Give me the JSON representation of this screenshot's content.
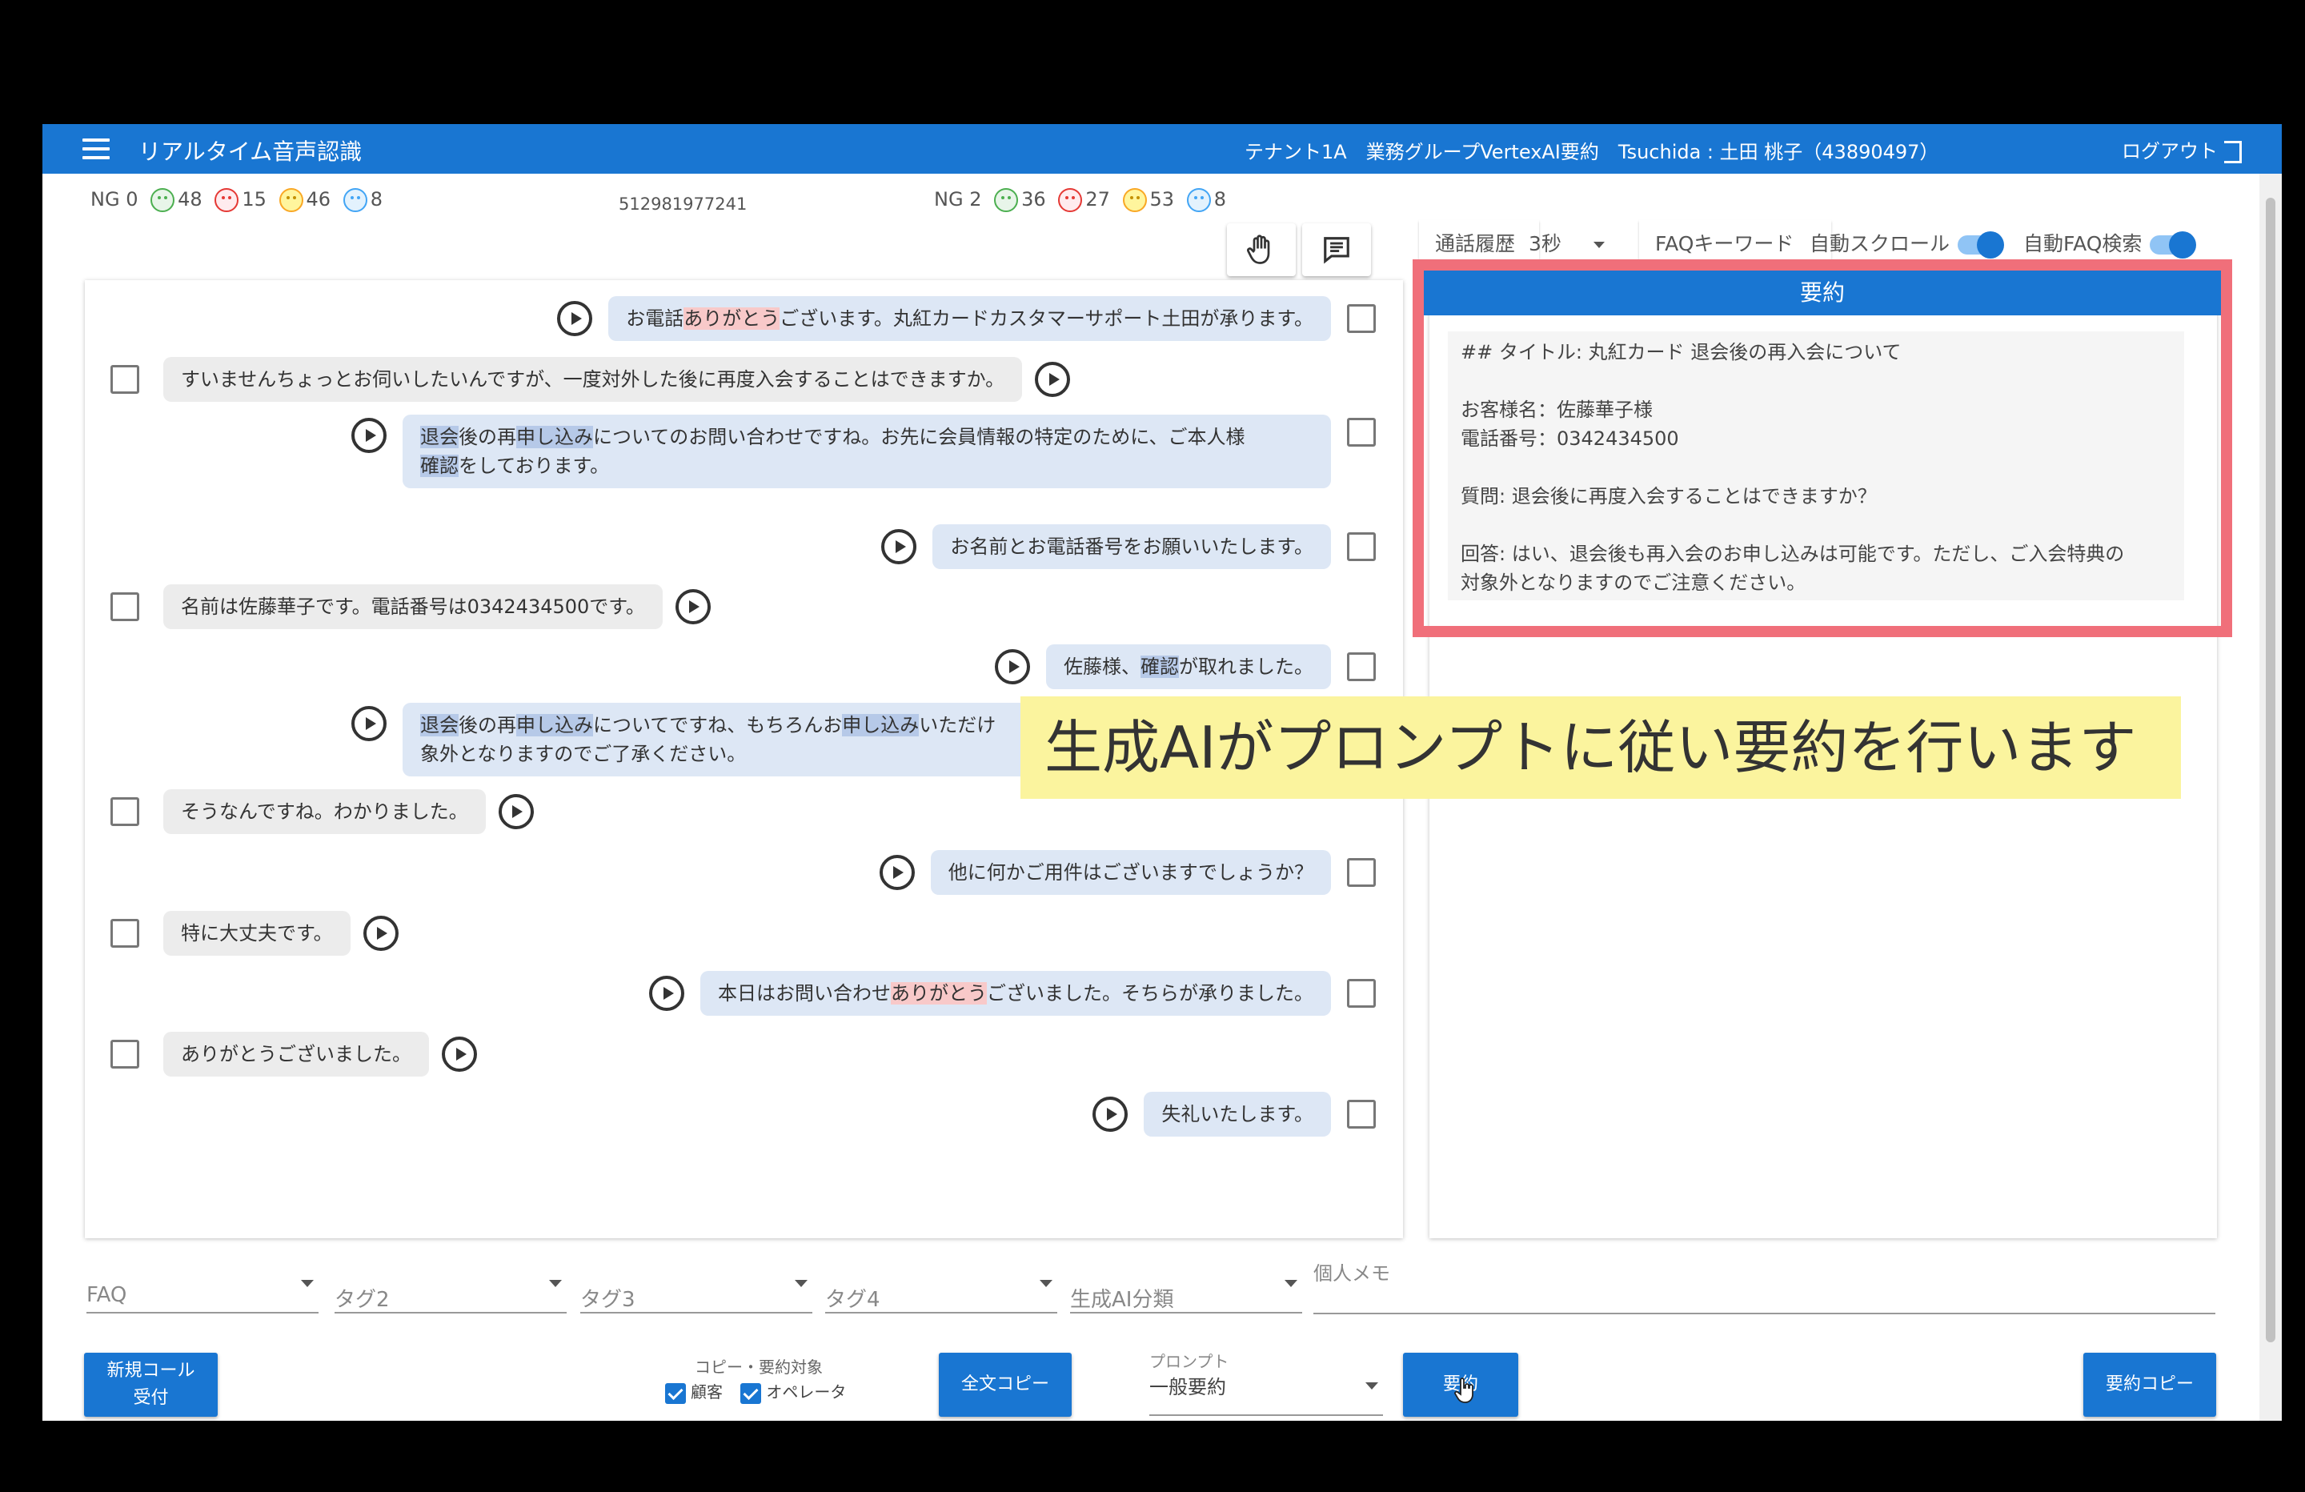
{
  "header": {
    "app_title": "リアルタイム音声認識",
    "user_info": "テナント1A　業務グループVertexAI要約　Tsuchida : 土田 桃子（43890497）",
    "logout_label": "ログアウト"
  },
  "stats_left": {
    "ng_label": "NG",
    "ng": "0",
    "happy": "48",
    "angry": "15",
    "neutral": "46",
    "sad": "8"
  },
  "call_id": "512981977241",
  "stats_right": {
    "ng_label": "NG",
    "ng": "2",
    "happy": "36",
    "angry": "27",
    "neutral": "53",
    "sad": "8"
  },
  "tabs": {
    "history": "通話履歴",
    "interval": "3秒",
    "faq_keyword": "FAQキーワード",
    "auto_scroll": "自動スクロール",
    "auto_faq": "自動FAQ検索"
  },
  "messages": [
    {
      "role": "operator",
      "pre": "お電話",
      "hl": "ありがとう",
      "hl_color": "red",
      "post": "ございます。丸紅カードカスタマーサポート土田が承ります。"
    },
    {
      "role": "customer",
      "text": "すいませんちょっとお伺いしたいんですが、一度対外した後に再度入会することはできますか。"
    },
    {
      "role": "operator",
      "line1_hl1": "退会",
      "line1_a": "後の再",
      "line1_hl2": "申し込み",
      "line1_b": "についてのお問い合わせですね。お先に会員情報の特定のために、ご本人様",
      "line2_hl": "確認",
      "line2_b": "をしております。"
    },
    {
      "role": "operator",
      "text": "お名前とお電話番号をお願いいたします。"
    },
    {
      "role": "customer",
      "text": "名前は佐藤華子です。電話番号は0342434500です。"
    },
    {
      "role": "operator",
      "pre": "佐藤様、",
      "hl": "確認",
      "hl_color": "blue",
      "post": "が取れました。"
    },
    {
      "role": "operator",
      "line1_hl1": "退会",
      "line1_a": "後の再",
      "line1_hl2": "申し込み",
      "line1_b": "についてですね、もちろんお",
      "line1_hl3": "申し込み",
      "line1_c": "いただけ",
      "line2": "象外となりますのでご了承ください。"
    },
    {
      "role": "customer",
      "text": "そうなんですね。わかりました。"
    },
    {
      "role": "operator",
      "text": "他に何かご用件はございますでしょうか？"
    },
    {
      "role": "customer",
      "text": "特に大丈夫です。"
    },
    {
      "role": "operator",
      "pre": "本日はお問い合わせ",
      "hl": "ありがとう",
      "hl_color": "red",
      "post": "ございました。そちらが承りました。"
    },
    {
      "role": "customer",
      "text": "ありがとうございました。"
    },
    {
      "role": "operator",
      "text": "失礼いたします。"
    }
  ],
  "summary": {
    "header": "要約",
    "title_line": "## タイトル: 丸紅カード 退会後の再入会について",
    "customer_name": "お客様名：佐藤華子様",
    "phone": "電話番号：0342434500",
    "question": "質問: 退会後に再度入会することはできますか？",
    "answer_line1": "回答: はい、退会後も再入会のお申し込みは可能です。ただし、ご入会特典の",
    "answer_line2": "対象外となりますのでご注意ください。"
  },
  "caption": "生成AIがプロンプトに従い要約を行います",
  "fields": {
    "faq": "FAQ",
    "tag2": "タグ2",
    "tag3": "タグ3",
    "tag4": "タグ4",
    "ai_category": "生成AI分類",
    "memo": "個人メモ"
  },
  "bottom": {
    "new_call_line1": "新規コール",
    "new_call_line2": "受付",
    "copy_target_label": "コピー・要約対象",
    "customer_check": "顧客",
    "operator_check": "オペレータ",
    "full_copy": "全文コピー",
    "prompt_label": "プロンプト",
    "prompt_value": "一般要約",
    "summarize": "要約",
    "summary_copy": "要約コピー"
  },
  "colors": {
    "primary": "#1976d2",
    "highlight_frame": "#f06f7a",
    "caption_bg": "#fbf49e"
  }
}
